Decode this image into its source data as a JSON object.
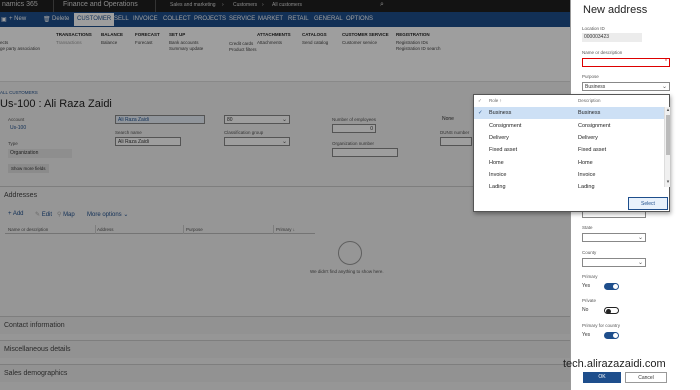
{
  "topbar": {
    "app_name": "namics 365",
    "module": "Finance and Operations",
    "crumb1": "Sales and marketing",
    "crumb2": "Customers",
    "crumb3": "All customers"
  },
  "actionbar": {
    "new": "New",
    "delete": "Delete",
    "tabs": [
      "CUSTOMER",
      "SELL",
      "INVOICE",
      "COLLECT",
      "PROJECTS",
      "SERVICE",
      "MARKET",
      "RETAIL",
      "GENERAL",
      "OPTIONS"
    ]
  },
  "ribbon": {
    "g0": {
      "items": [
        "ects",
        "ge party association"
      ]
    },
    "g1": {
      "title": "TRANSACTIONS",
      "items": [
        "Transactions"
      ]
    },
    "g2": {
      "title": "BALANCE",
      "items": [
        "Balance"
      ]
    },
    "g3": {
      "title": "FORECAST",
      "items": [
        "Forecast"
      ]
    },
    "g4": {
      "title": "SET UP",
      "items": [
        "Bank accounts",
        "Summary update",
        "Credit cards",
        "Product filters"
      ]
    },
    "g5": {
      "title": "ATTACHMENTS",
      "items": [
        "Attachments"
      ]
    },
    "g6": {
      "title": "CATALOGS",
      "items": [
        "Send catalog"
      ]
    },
    "g7": {
      "title": "CUSTOMER SERVICE",
      "items": [
        "Customer service"
      ]
    },
    "g8": {
      "title": "REGISTRATION",
      "items": [
        "Registration IDs",
        "Registration ID search"
      ]
    }
  },
  "page": {
    "crumb": "ALL CUSTOMERS",
    "title": "Us-100 : Ali Raza Zaidi"
  },
  "form": {
    "account_label": "Account",
    "account_value": "Us-100",
    "type_label": "Type",
    "type_value": "Organization",
    "show_more": "Show more fields",
    "name_value": "Ali Raza Zaidi",
    "search_name_label": "Search name",
    "search_name_value": "Ali Raza Zaidi",
    "group_value": "80",
    "classification_label": "Classification group",
    "employees_label": "Number of employees",
    "employees_value": "0",
    "org_number_label": "Organization number",
    "none_value": "None",
    "duns_label": "DUNS number"
  },
  "addresses": {
    "heading": "Addresses",
    "add": "+ Add",
    "edit": "Edit",
    "map": "Map",
    "more": "More options",
    "cols": [
      "Name or description",
      "Address",
      "Purpose",
      "Primary ↓"
    ],
    "empty": "We didn't find anything to show here."
  },
  "sections": [
    "Contact information",
    "Miscellaneous details",
    "Sales demographics"
  ],
  "panel": {
    "title": "New address",
    "location_id_label": "Location ID",
    "location_id_value": "000003423",
    "name_label": "Name or description",
    "name_value": "",
    "purpose_label": "Purpose",
    "purpose_value": "Business",
    "state_label": "State",
    "county_label": "County",
    "primary_label": "Primary",
    "primary_value": "Yes",
    "private_label": "Private",
    "private_value": "No",
    "primary_country_label": "Primary for country",
    "primary_country_value": "Yes",
    "ok": "OK",
    "cancel": "Cancel"
  },
  "dropdown": {
    "col_role": "Role ↑",
    "col_desc": "Description",
    "rows": [
      {
        "role": "Business",
        "desc": "Business"
      },
      {
        "role": "Consignment",
        "desc": "Consignment"
      },
      {
        "role": "Delivery",
        "desc": "Delivery"
      },
      {
        "role": "Fixed asset",
        "desc": "Fixed asset"
      },
      {
        "role": "Home",
        "desc": "Home"
      },
      {
        "role": "Invoice",
        "desc": "Invoice"
      },
      {
        "role": "Lading",
        "desc": "Lading"
      }
    ],
    "select": "Select"
  },
  "watermark": "tech.alirazazaidi.com",
  "colors": {
    "accent": "#1e4e8c",
    "required": "#dd0000"
  }
}
